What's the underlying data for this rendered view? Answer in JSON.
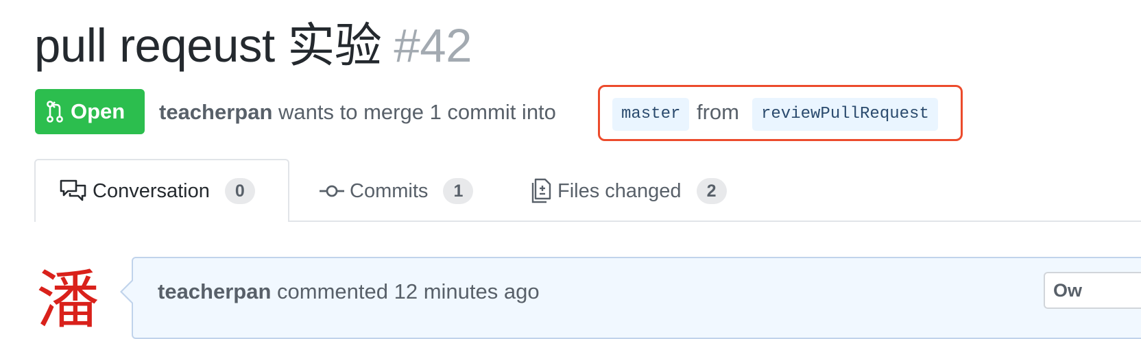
{
  "title": {
    "text": "pull reqeust 实验",
    "number": "#42"
  },
  "status": {
    "label": "Open",
    "color": "#2cbe4e"
  },
  "meta": {
    "author": "teacherpan",
    "text": "wants to merge 1 commit into",
    "base_branch": "master",
    "from": "from",
    "head_branch": "reviewPullRequest",
    "highlight_color": "#ec4b2c"
  },
  "tabs": [
    {
      "label": "Conversation",
      "count": "0"
    },
    {
      "label": "Commits",
      "count": "1"
    },
    {
      "label": "Files changed",
      "count": "2"
    }
  ],
  "comment": {
    "avatar_char": "潘",
    "author": "teacherpan",
    "action": "commented",
    "time": "12 minutes ago",
    "role_badge": "Ow"
  }
}
